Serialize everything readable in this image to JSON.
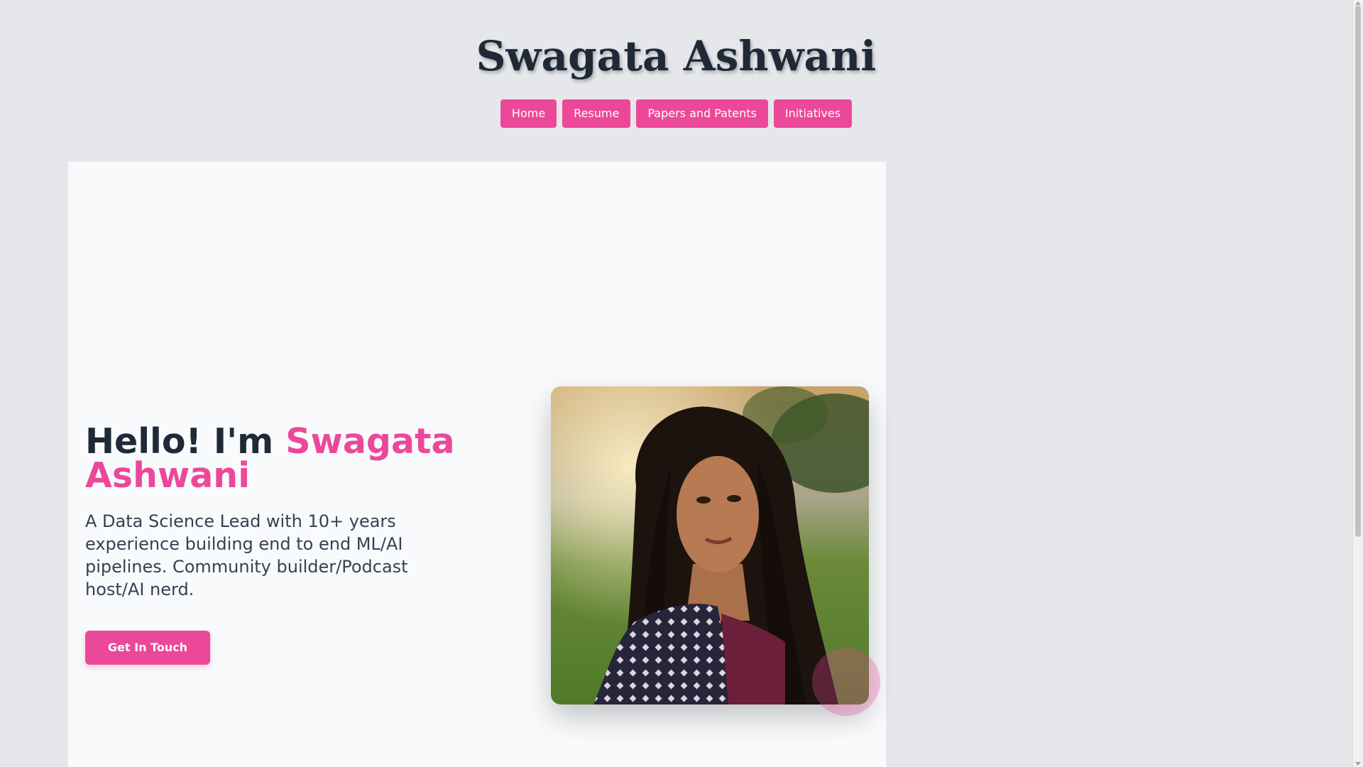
{
  "header": {
    "title": "Swagata Ashwani"
  },
  "nav": {
    "items": [
      {
        "label": "Home"
      },
      {
        "label": "Resume"
      },
      {
        "label": "Papers and Patents"
      },
      {
        "label": "Initiatives"
      }
    ]
  },
  "hero": {
    "greeting": "Hello! I'm ",
    "name": "Swagata Ashwani",
    "description": "A Data Science Lead with 10+ years experience building end to end ML/AI pipelines. Community builder/Podcast host/AI nerd.",
    "cta_label": "Get In Touch"
  },
  "colors": {
    "accent": "#ec4899",
    "heading": "#1f2937",
    "background": "#e5e7eb",
    "card": "#f8fafc"
  },
  "icons": {
    "portrait": "profile-photo"
  }
}
